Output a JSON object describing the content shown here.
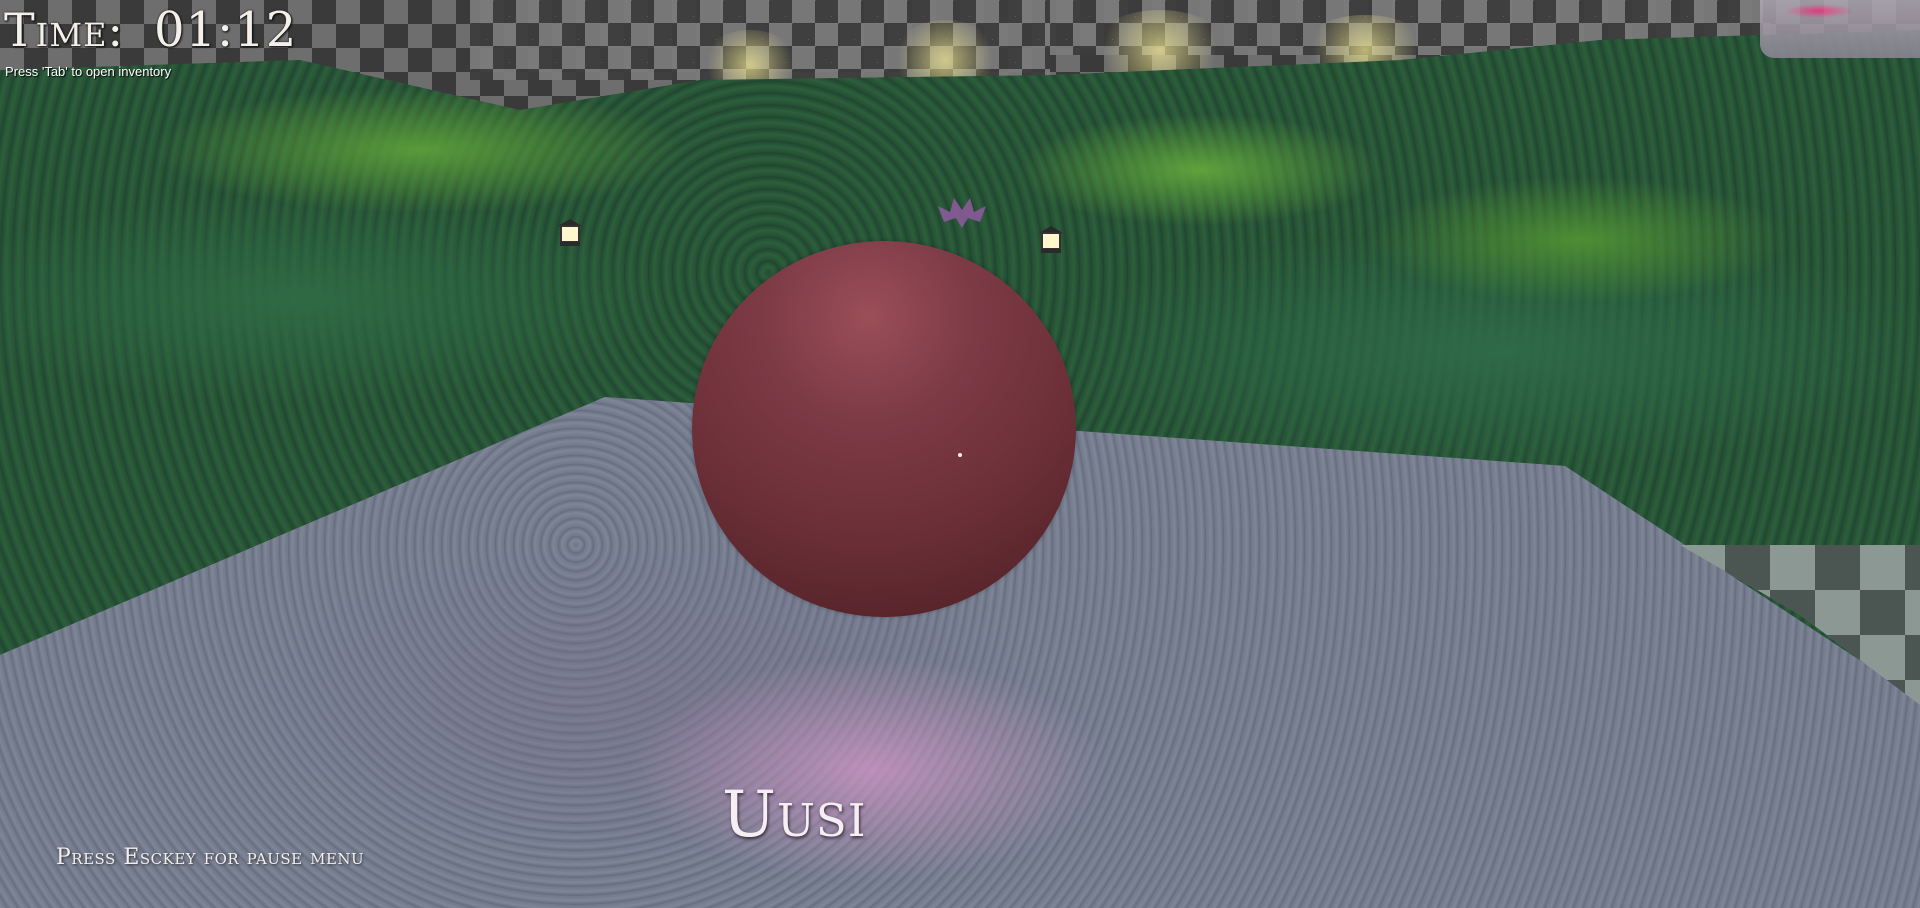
{
  "hud": {
    "time_label": "Time:",
    "time_value": "01:12",
    "inventory_hint": "Press 'Tab' to open inventory",
    "pause_hint": "Press Esckey for pause menu",
    "focused_object_name": "Uusi"
  },
  "scene": {
    "description_icons": [
      "lantern-icon",
      "bat-icon",
      "crosshair-icon"
    ],
    "colors": {
      "sphere": "#7c3a45",
      "hedge": "#2d5f3c",
      "floor": "#737b8c",
      "hud_text": "#f3f0ea"
    }
  }
}
